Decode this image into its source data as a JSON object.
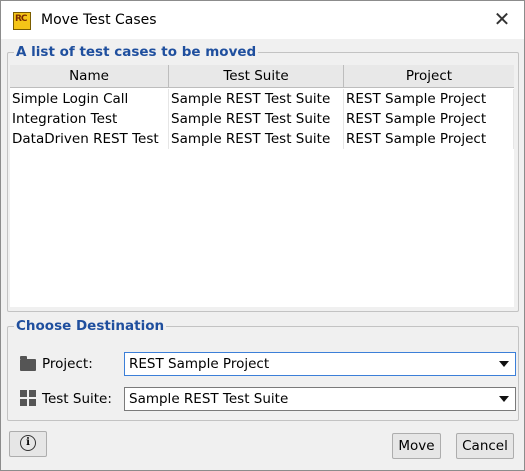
{
  "window": {
    "title": "Move Test Cases",
    "app_icon_text": "RC",
    "close_glyph": "✕"
  },
  "test_cases": {
    "legend": "A list of test cases to be moved",
    "columns": [
      "Name",
      "Test Suite",
      "Project"
    ],
    "rows": [
      [
        "Simple Login Call",
        "Sample REST Test Suite",
        "REST Sample Project"
      ],
      [
        "Integration Test",
        "Sample REST Test Suite",
        "REST Sample Project"
      ],
      [
        "DataDriven REST Test",
        "Sample REST Test Suite",
        "REST Sample Project"
      ]
    ]
  },
  "destination": {
    "legend": "Choose Destination",
    "project_label": "Project:",
    "project_value": "REST Sample Project",
    "suite_label": "Test Suite:",
    "suite_value": "Sample REST Test Suite"
  },
  "buttons": {
    "info_glyph": "i",
    "move": "Move",
    "cancel": "Cancel"
  },
  "colors": {
    "legend": "#1f4f9e",
    "focus_border": "#3c7fd8"
  },
  "icons": [
    "app-icon",
    "close-icon",
    "folder-icon",
    "grid-icon",
    "info-icon",
    "chevron-down-icon"
  ]
}
